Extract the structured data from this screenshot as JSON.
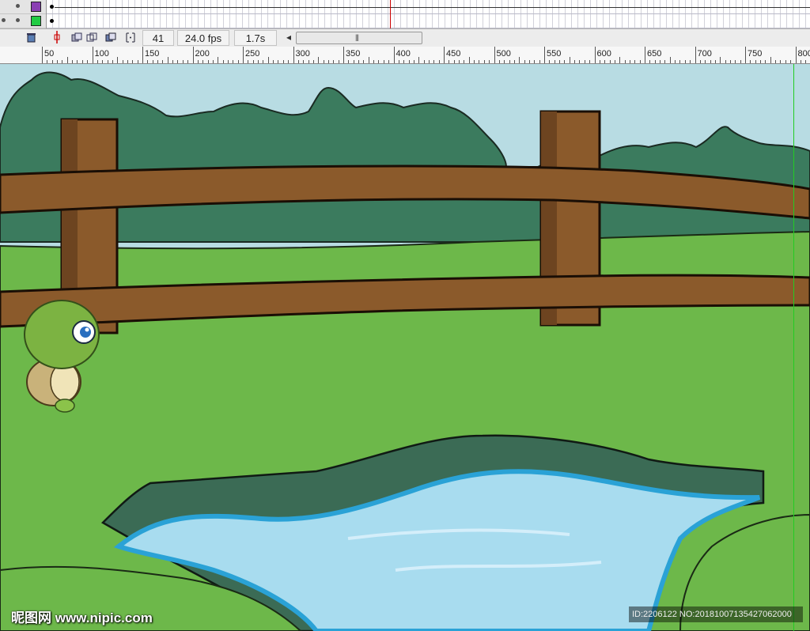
{
  "timeline": {
    "layers": [
      {
        "swatch_color": "#8a3fb3"
      },
      {
        "swatch_color": "#22cc44"
      }
    ],
    "toolbar": {
      "current_frame": "41",
      "frame_rate": "24.0 fps",
      "elapsed_time": "1.7s",
      "scroll_left_arrow": "◂",
      "scroll_grip": "|||"
    }
  },
  "ruler": {
    "labels": [
      "50",
      "100",
      "150",
      "200",
      "250",
      "300",
      "350",
      "400",
      "450",
      "500",
      "550",
      "600",
      "650",
      "700",
      "750",
      "800"
    ]
  },
  "stage": {
    "watermark_left": "昵图网 www.nipic.com",
    "watermark_right": "ID:2206122 NO:20181007135427062000"
  },
  "colors": {
    "sky": "#b8dce3",
    "grass": "#6db84a",
    "trees": "#3b7b5e",
    "fence_wood": "#8b5a2b",
    "water": "#a8dcef",
    "water_edge": "#2aa2d6",
    "turtle_head": "#7cb342",
    "guide": "#22cc22",
    "playhead": "#cc0000"
  },
  "icons": {
    "delete": "trash-icon",
    "center_frame": "center-frame-icon",
    "onion_skin": "onion-skin-icon",
    "onion_outline": "onion-skin-outline-icon",
    "edit_multiple": "edit-multiple-frames-icon",
    "onion_markers": "modify-onion-markers-icon"
  }
}
